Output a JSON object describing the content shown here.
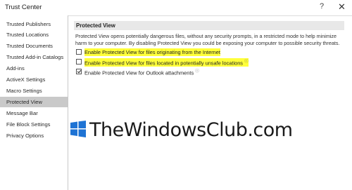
{
  "window": {
    "title": "Trust Center",
    "help_glyph": "?",
    "close_glyph": "✕"
  },
  "sidebar": {
    "items": [
      {
        "label": "Trusted Publishers",
        "active": false
      },
      {
        "label": "Trusted Locations",
        "active": false
      },
      {
        "label": "Trusted Documents",
        "active": false
      },
      {
        "label": "Trusted Add-in Catalogs",
        "active": false
      },
      {
        "label": "Add-ins",
        "active": false
      },
      {
        "label": "ActiveX Settings",
        "active": false
      },
      {
        "label": "Macro Settings",
        "active": false
      },
      {
        "label": "Protected View",
        "active": true
      },
      {
        "label": "Message Bar",
        "active": false
      },
      {
        "label": "File Block Settings",
        "active": false
      },
      {
        "label": "Privacy Options",
        "active": false
      }
    ]
  },
  "main": {
    "section_title": "Protected View",
    "description": "Protected View opens potentially dangerous files, without any security prompts, in a restricted mode to help minimize harm to your computer. By disabling Protected View you could be exposing your computer to possible security threats.",
    "options": [
      {
        "label": "Enable Protected View for files originating from the Internet",
        "checked": false,
        "highlighted": true,
        "info_icon": false
      },
      {
        "label": "Enable Protected View for files located in potentially unsafe locations",
        "checked": false,
        "highlighted": true,
        "info_icon": true
      },
      {
        "label": "Enable Protected View for Outlook attachments",
        "checked": true,
        "highlighted": false,
        "info_icon": true
      }
    ]
  },
  "watermark": {
    "text": "TheWindowsClub.com",
    "logo_color": "#1e73d4"
  },
  "colors": {
    "highlight": "#ffff3a",
    "active_nav": "#c9c9c9",
    "section_header": "#e8e8e8"
  }
}
